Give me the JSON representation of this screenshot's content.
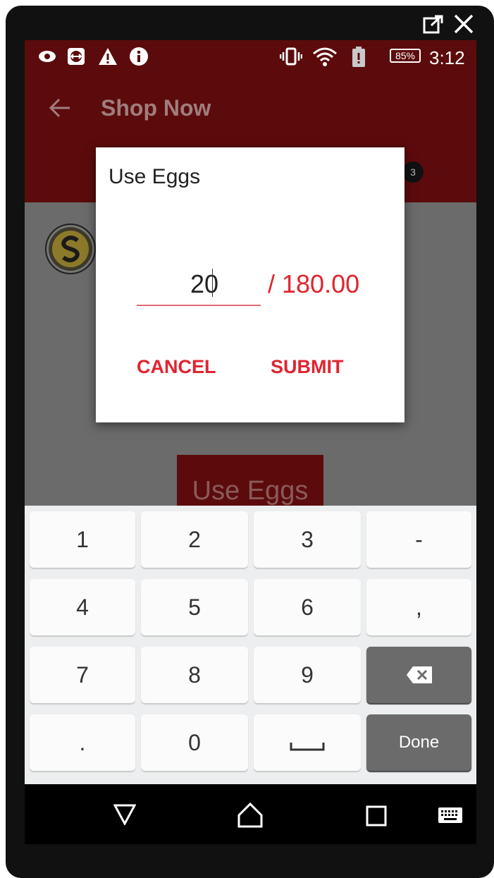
{
  "status": {
    "battery": "85%",
    "time": "3:12"
  },
  "app": {
    "title": "Shop Now",
    "cart_count": "3"
  },
  "page": {
    "use_button_label": "Use Eggs"
  },
  "dialog": {
    "title": "Use Eggs",
    "value": "20",
    "total": "/ 180.00",
    "cancel_label": "CANCEL",
    "submit_label": "SUBMIT"
  },
  "keyboard": {
    "keys": [
      "1",
      "2",
      "3",
      "-",
      "4",
      "5",
      "6",
      ",",
      "7",
      "8",
      "9",
      ".",
      "0"
    ],
    "done_label": "Done"
  },
  "colors": {
    "primary": "#5c0b0c",
    "accent": "#e0242f"
  },
  "icons": [
    "eye-icon",
    "teamviewer-icon",
    "warning-icon",
    "info-icon",
    "vibrate-icon",
    "wifi-icon",
    "battery-alert-icon",
    "back-arrow-icon",
    "popout-icon",
    "close-icon",
    "backspace-icon",
    "space-icon",
    "nav-back-icon",
    "nav-home-icon",
    "nav-recents-icon",
    "keyboard-icon"
  ]
}
